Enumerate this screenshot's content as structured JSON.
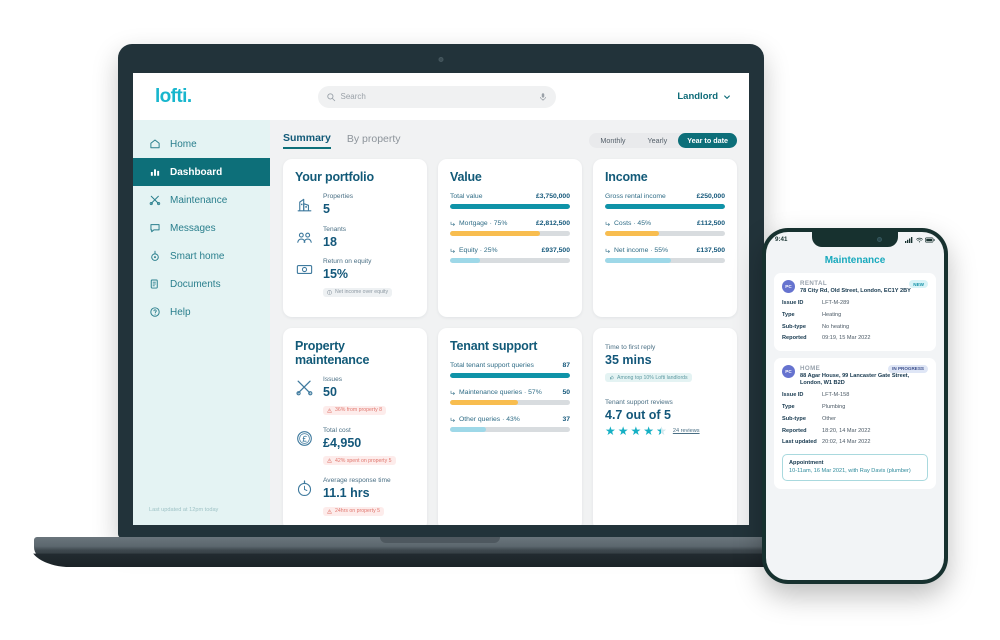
{
  "brand": {
    "logo": "lofti",
    "logo_dot": ".",
    "accent": "#18b6cd",
    "primary": "#0d6f79",
    "deep": "#125a78"
  },
  "topbar": {
    "search_placeholder": "Search",
    "search_value": "",
    "search_icon": "search-icon",
    "mic_icon": "microphone-icon",
    "user_label": "Landlord",
    "chevron": "chevron-down-icon"
  },
  "sidebar": {
    "items": [
      {
        "label": "Home",
        "icon": "home-icon",
        "active": false
      },
      {
        "label": "Dashboard",
        "icon": "bar-chart-icon",
        "active": true
      },
      {
        "label": "Maintenance",
        "icon": "tools-icon",
        "active": false
      },
      {
        "label": "Messages",
        "icon": "chat-bubble-icon",
        "active": false
      },
      {
        "label": "Smart home",
        "icon": "thermostat-icon",
        "active": false
      },
      {
        "label": "Documents",
        "icon": "documents-icon",
        "active": false
      },
      {
        "label": "Help",
        "icon": "question-circle-icon",
        "active": false
      }
    ],
    "footer": "Last updated at 12pm today"
  },
  "tabs": [
    {
      "label": "Summary",
      "active": true
    },
    {
      "label": "By property",
      "active": false
    }
  ],
  "period_filter": {
    "options": [
      {
        "label": "Monthly",
        "active": false
      },
      {
        "label": "Yearly",
        "active": false
      },
      {
        "label": "Year to date",
        "active": true
      }
    ]
  },
  "cards": {
    "portfolio": {
      "title": "Your portfolio",
      "stats": [
        {
          "icon": "houses-icon",
          "label": "Properties",
          "value": "5",
          "chip": null
        },
        {
          "icon": "tenants-icon",
          "label": "Tenants",
          "value": "18",
          "chip": null
        },
        {
          "icon": "cash-icon",
          "label": "Return on equity",
          "value": "15%",
          "chip": "Net income over equity",
          "chip_icon": "info-icon",
          "chip_kind": "neutral"
        }
      ]
    },
    "value": {
      "title": "Value",
      "bars": [
        {
          "name": "Total value",
          "value": "£3,750,000",
          "pct": 100,
          "color": "#0f93a8",
          "sub": false
        },
        {
          "name": "Mortgage · 75%",
          "value": "£2,812,500",
          "pct": 75,
          "color": "#f8bd4f",
          "sub": true
        },
        {
          "name": "Equity · 25%",
          "value": "£937,500",
          "pct": 25,
          "color": "#9ed8e8",
          "sub": true
        }
      ]
    },
    "income": {
      "title": "Income",
      "bars": [
        {
          "name": "Gross rental income",
          "value": "£250,000",
          "pct": 100,
          "color": "#0f93a8",
          "sub": false
        },
        {
          "name": "Costs · 45%",
          "value": "£112,500",
          "pct": 45,
          "color": "#f8bd4f",
          "sub": true
        },
        {
          "name": "Net income · 55%",
          "value": "£137,500",
          "pct": 55,
          "color": "#9ed8e8",
          "sub": true
        }
      ]
    },
    "maintenance": {
      "title": "Property maintenance",
      "stats": [
        {
          "icon": "tools-icon",
          "label": "Issues",
          "value": "50",
          "chip": "36% from property 8",
          "chip_icon": "warning-icon",
          "chip_kind": "warn"
        },
        {
          "icon": "pound-coin-icon",
          "label": "Total cost",
          "value": "£4,950",
          "chip": "42% spent on property 5",
          "chip_icon": "warning-icon",
          "chip_kind": "warn"
        },
        {
          "icon": "stopwatch-icon",
          "label": "Average response time",
          "value": "11.1 hrs",
          "chip": "24hrs on property 5",
          "chip_icon": "warning-icon",
          "chip_kind": "warn"
        }
      ]
    },
    "tenant_support": {
      "title": "Tenant support",
      "bars": [
        {
          "name": "Total tenant support queries",
          "value": "87",
          "pct": 100,
          "color": "#0f93a8",
          "sub": false
        },
        {
          "name": "Maintenance queries · 57%",
          "value": "50",
          "pct": 57,
          "color": "#f8bd4f",
          "sub": true
        },
        {
          "name": "Other queries · 43%",
          "value": "37",
          "pct": 43,
          "color": "#9ed8e8",
          "sub": true
        }
      ]
    },
    "support_metrics": {
      "reply": {
        "label": "Time to first reply",
        "value": "35 mins",
        "chip": "Among top 10% Lofti landlords",
        "chip_icon": "thumbs-up-icon"
      },
      "reviews": {
        "label": "Tenant support reviews",
        "value": "4.7 out of 5",
        "rating": 4.7,
        "reviews_link": "24 reviews"
      }
    }
  },
  "phone": {
    "status": {
      "time": "9:41",
      "signal_icon": "signal-icon",
      "wifi_icon": "wifi-icon",
      "battery_icon": "battery-icon"
    },
    "title": "Maintenance",
    "issues": [
      {
        "avatar": "PC",
        "category": "RENTAL",
        "badge": "NEW",
        "badge_kind": "new",
        "address": "78 City Rd, Old Street, London, EC1Y 2BY",
        "fields": [
          {
            "key": "Issue ID",
            "value": "LFT-M-289"
          },
          {
            "key": "Type",
            "value": "Heating"
          },
          {
            "key": "Sub-type",
            "value": "No heating"
          },
          {
            "key": "Reported",
            "value": "09:19, 15 Mar 2022"
          }
        ],
        "appointment": null
      },
      {
        "avatar": "PC",
        "category": "HOME",
        "badge": "IN PROGRESS",
        "badge_kind": "prog",
        "address": "88 Agar House, 99 Lancaster Gate Street, London, W1 B2D",
        "fields": [
          {
            "key": "Issue ID",
            "value": "LFT-M-158"
          },
          {
            "key": "Type",
            "value": "Plumbing"
          },
          {
            "key": "Sub-type",
            "value": "Other"
          },
          {
            "key": "Reported",
            "value": "18:20, 14 Mar 2022"
          },
          {
            "key": "Last updated",
            "value": "20:02, 14 Mar 2022"
          }
        ],
        "appointment": {
          "title": "Appointment",
          "detail": "10-11am, 16 Mar 2021, with Ray Davis (plumber)"
        }
      }
    ]
  }
}
